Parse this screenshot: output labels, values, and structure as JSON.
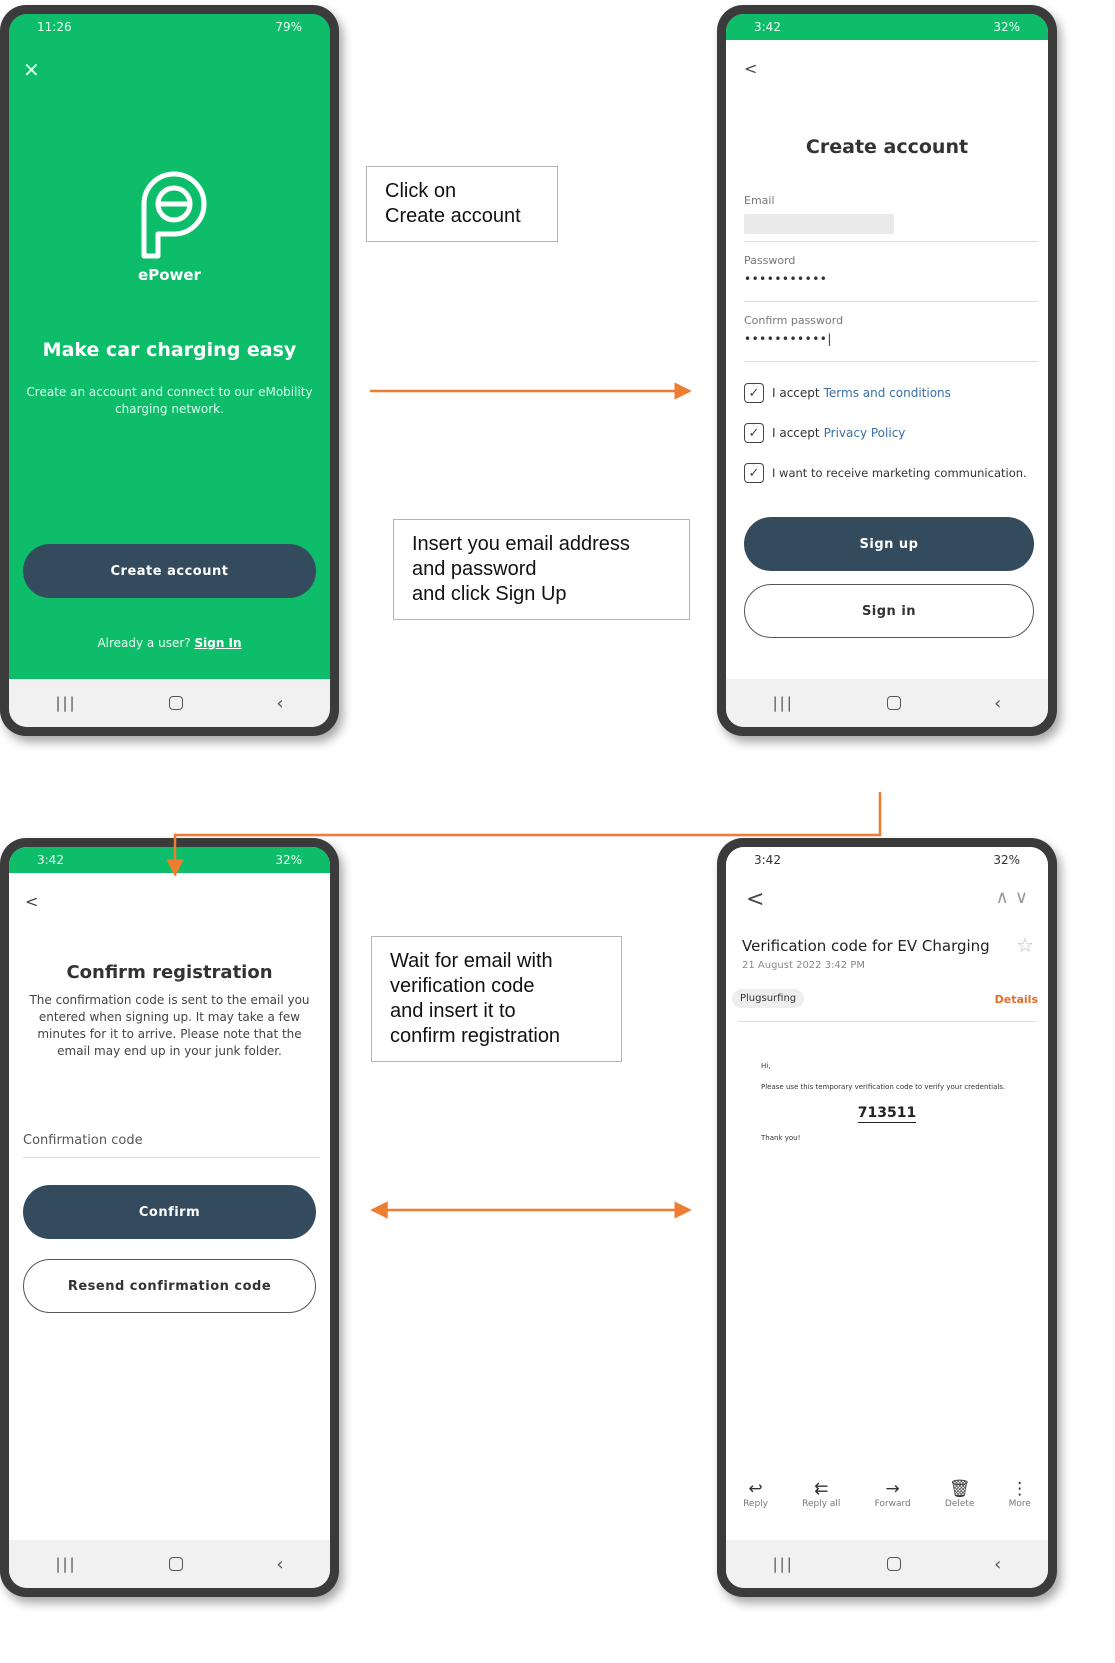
{
  "phone1": {
    "status_time": "11:26",
    "status_right": "79%",
    "close_icon": "close-icon",
    "brand": "ePower",
    "title": "Make car charging easy",
    "subtitle": "Create an account and connect to our eMobility charging network.",
    "create_account_label": "Create account",
    "already_text": "Already a user?",
    "sign_in_link": "Sign In"
  },
  "callout1": {
    "line1": "Click on",
    "line2": "Create account"
  },
  "phone2": {
    "status_time": "3:42",
    "status_right": "32%",
    "title": "Create account",
    "email_label": "Email",
    "password_label": "Password",
    "password_value": "•••••••••••",
    "confirm_label": "Confirm password",
    "confirm_value": "•••••••••••|",
    "check1_prefix": "I accept",
    "check1_link": "Terms and conditions",
    "check2_prefix": "I accept",
    "check2_link": "Privacy Policy",
    "check3_text": "I want to receive marketing communication.",
    "sign_up_label": "Sign up",
    "sign_in_label": "Sign in"
  },
  "callout2": {
    "line1": "Insert you email address",
    "line2": "and password",
    "line3": "and click Sign Up"
  },
  "phone3": {
    "status_time": "3:42",
    "status_right": "32%",
    "title": "Confirm registration",
    "description": "The confirmation code is sent to the email you entered when signing up. It may take a few minutes for it to arrive. Please note that the email may end up in your junk folder.",
    "code_label": "Confirmation code",
    "confirm_label": "Confirm",
    "resend_label": "Resend confirmation code"
  },
  "callout3": {
    "line1": "Wait for email with",
    "line2": "verification code",
    "line3": "and insert it to",
    "line4": "confirm registration"
  },
  "phone4": {
    "status_time": "3:42",
    "status_right": "32%",
    "subject": "Verification code for EV Charging",
    "date": "21 August 2022  3:42 PM",
    "sender": "Plugsurfing",
    "details": "Details",
    "greeting": "Hi,",
    "body": "Please use this temporary verification code to verify your credentials.",
    "code": "713511",
    "thanks": "Thank you!",
    "tools": [
      "Reply",
      "Reply all",
      "Forward",
      "Delete",
      "More"
    ]
  },
  "colors": {
    "brand_green": "#0dbd6a",
    "button_dark": "#344b5e",
    "arrow_orange": "#ed7d31",
    "link_blue": "#3a6ea5",
    "details_orange": "#e06d2a"
  }
}
